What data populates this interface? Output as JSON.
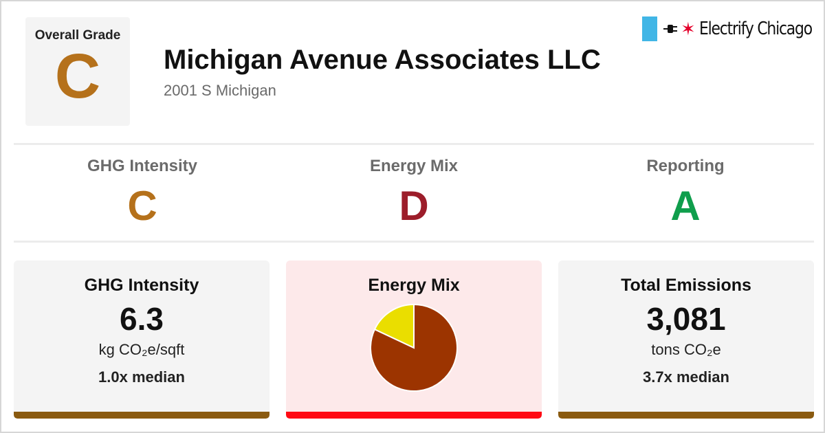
{
  "colors": {
    "grade_c": "#b5711b",
    "grade_d": "#9c1d2a",
    "grade_a": "#0f9e4c",
    "bar_c": "#8a5a10",
    "bar_d": "#ff0a14",
    "energy_card_bg": "#fde9ea",
    "pie_main": "#9c3400",
    "pie_small": "#eade00"
  },
  "header": {
    "overall_grade_label": "Overall Grade",
    "overall_grade": "C",
    "title": "Michigan Avenue Associates LLC",
    "address": "2001 S Michigan",
    "brand_name": "Electrify Chicago",
    "brand_icons": [
      "chicago-flag-icon",
      "plug-icon",
      "star-icon"
    ]
  },
  "sub_grades": [
    {
      "label": "GHG Intensity",
      "grade": "C"
    },
    {
      "label": "Energy Mix",
      "grade": "D"
    },
    {
      "label": "Reporting",
      "grade": "A"
    }
  ],
  "cards": {
    "ghg": {
      "title": "GHG Intensity",
      "value": "6.3",
      "unit": "kg CO₂e/sqft",
      "median": "1.0x median"
    },
    "energy": {
      "title": "Energy Mix"
    },
    "emissions": {
      "title": "Total Emissions",
      "value": "3,081",
      "unit": "tons CO₂e",
      "median": "3.7x median"
    }
  },
  "chart_data": {
    "type": "pie",
    "slices": [
      {
        "value": 0.82,
        "color": "#9c3400"
      },
      {
        "value": 0.18,
        "color": "#eade00"
      }
    ]
  }
}
